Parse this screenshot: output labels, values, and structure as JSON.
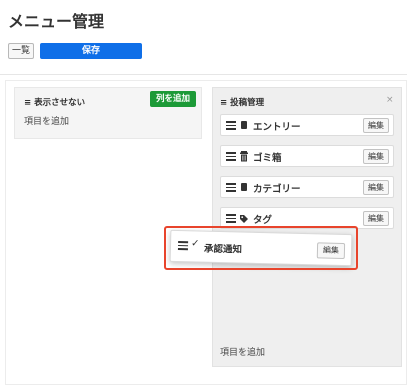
{
  "page": {
    "title": "メニュー管理"
  },
  "toolbar": {
    "list_label": "一覧",
    "save_label": "保存"
  },
  "left_column": {
    "title": "≡ 表示させない",
    "add_column_label": "列を追加",
    "add_item_label": "項目を追加"
  },
  "right_column": {
    "title": "≡ 投稿管理",
    "close_symbol": "×",
    "add_item_label": "項目を追加",
    "items": [
      {
        "label": "エントリー",
        "icon": "document-icon",
        "edit_label": "編集"
      },
      {
        "label": "ゴミ箱",
        "icon": "trash-icon",
        "edit_label": "編集"
      },
      {
        "label": "カテゴリー",
        "icon": "document-icon",
        "edit_label": "編集"
      },
      {
        "label": "タグ",
        "icon": "tag-icon",
        "edit_label": "編集"
      }
    ]
  },
  "dragging_item": {
    "label": "承認通知",
    "icon": "check-icon",
    "edit_label": "編集"
  },
  "colors": {
    "save": "#0f6fe8",
    "add_column": "#1c9a37",
    "highlight": "#e8442c"
  }
}
